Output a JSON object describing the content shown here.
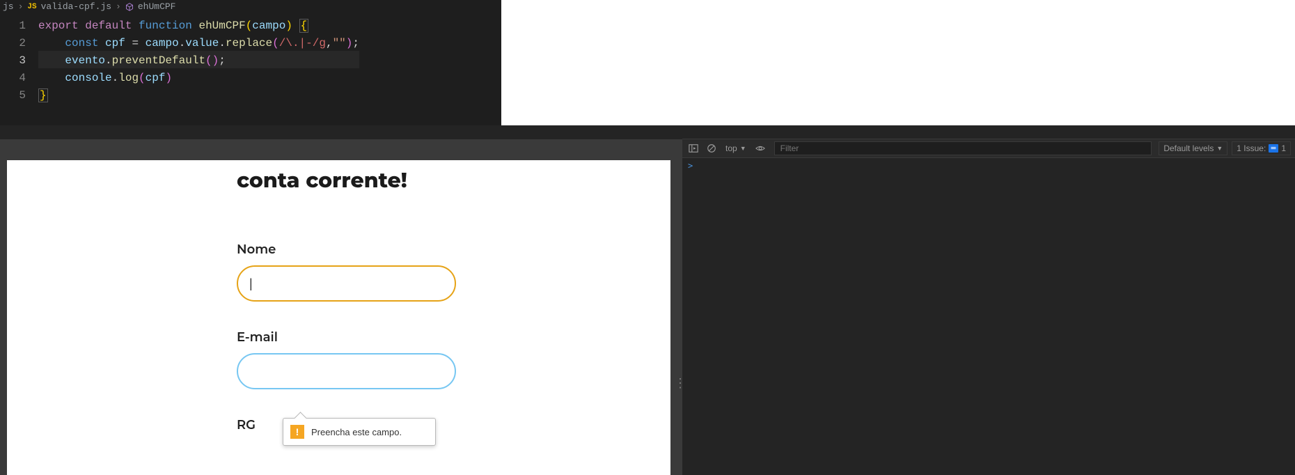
{
  "editor": {
    "breadcrumb": {
      "folder": "js",
      "file": "valida-cpf.js",
      "symbol": "ehUmCPF"
    },
    "gutter": [
      "1",
      "2",
      "3",
      "4",
      "5"
    ],
    "active_line_index": 2,
    "code": {
      "l1": {
        "export": "export",
        "default": "default",
        "function": "function",
        "name": "ehUmCPF",
        "param": "campo"
      },
      "l2": {
        "const": "const",
        "cpf": "cpf",
        "campo": "campo",
        "value": "value",
        "replace": "replace",
        "regex": "/\\.|-/g",
        "empty": "\"\""
      },
      "l3": {
        "evento": "evento",
        "prevent": "preventDefault"
      },
      "l4": {
        "console": "console",
        "log": "log",
        "cpf": "cpf"
      }
    }
  },
  "page": {
    "heading": "conta corrente!",
    "labels": {
      "nome": "Nome",
      "email": "E-mail",
      "rg": "RG"
    },
    "tooltip": "Preencha este campo."
  },
  "devtools": {
    "top_dropdown": "top",
    "filter_placeholder": "Filter",
    "levels": "Default levels",
    "issues_label": "1 Issue:",
    "issues_count": "1",
    "prompt": ">"
  }
}
